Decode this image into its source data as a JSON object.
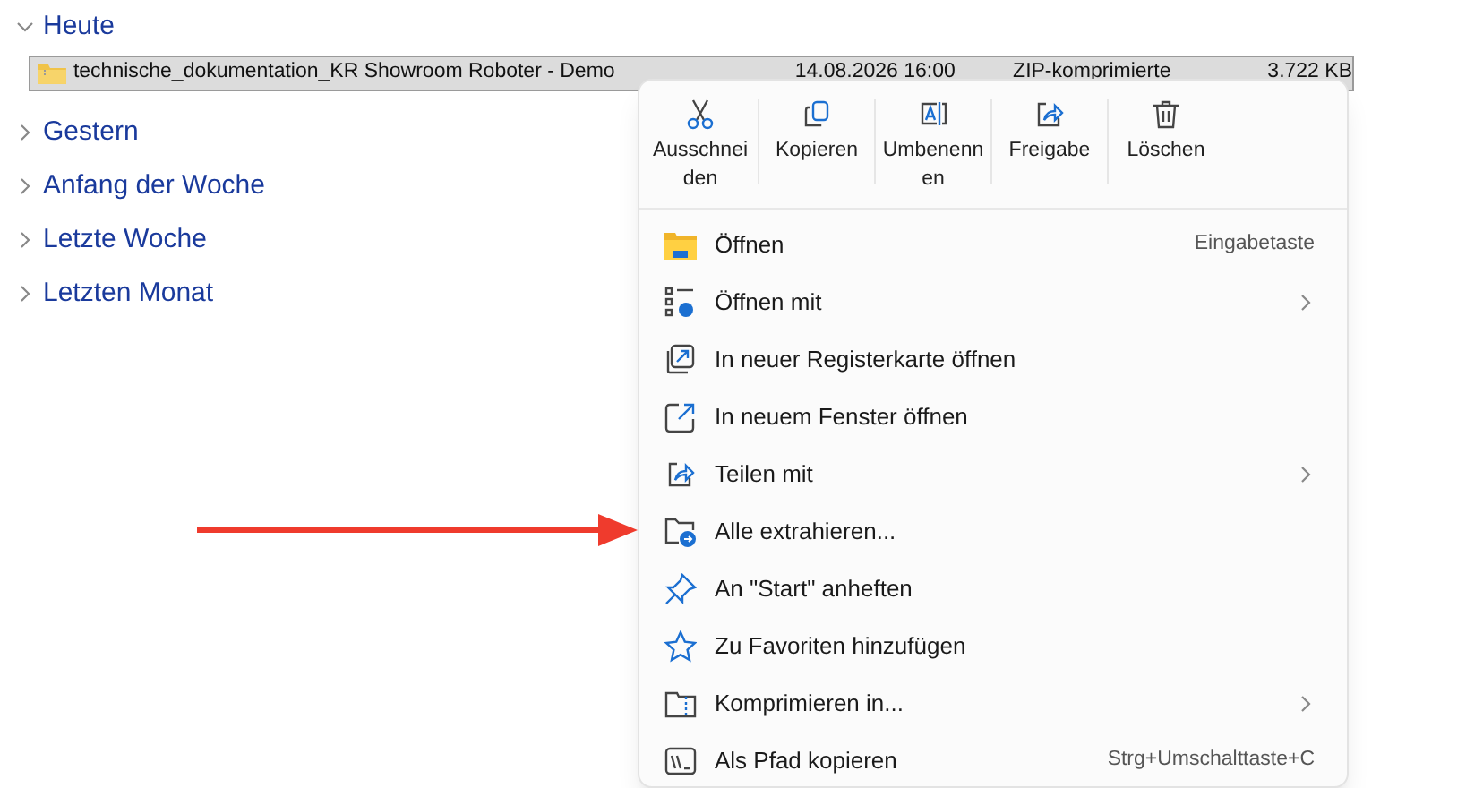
{
  "groups": [
    {
      "label": "Heute",
      "expanded": true,
      "files": [
        {
          "name": "technische_dokumentation_KR Showroom Roboter - Demo",
          "date": "14.08.2026 16:00",
          "type": "ZIP-komprimierte",
          "size": "3.722 KB",
          "selected": true
        }
      ]
    },
    {
      "label": "Gestern",
      "expanded": false
    },
    {
      "label": "Anfang der Woche",
      "expanded": false
    },
    {
      "label": "Letzte Woche",
      "expanded": false
    },
    {
      "label": "Letzten Monat",
      "expanded": false
    }
  ],
  "context_menu": {
    "actions": [
      {
        "label": "Ausschnei den"
      },
      {
        "label": "Kopieren"
      },
      {
        "label": "Umbenenn en"
      },
      {
        "label": "Freigabe"
      },
      {
        "label": "Löschen"
      }
    ],
    "items": [
      {
        "label": "Öffnen",
        "shortcut": "Eingabetaste",
        "submenu": false
      },
      {
        "label": "Öffnen mit",
        "submenu": true
      },
      {
        "label": "In neuer Registerkarte öffnen",
        "submenu": false
      },
      {
        "label": "In neuem Fenster öffnen",
        "submenu": false
      },
      {
        "label": "Teilen mit",
        "submenu": true
      },
      {
        "label": "Alle extrahieren...",
        "submenu": false
      },
      {
        "label": "An \"Start\" anheften",
        "submenu": false
      },
      {
        "label": "Zu Favoriten hinzufügen",
        "submenu": false
      },
      {
        "label": "Komprimieren in...",
        "submenu": true
      },
      {
        "label": "Als Pfad kopieren",
        "shortcut": "Strg+Umschalttaste+C",
        "submenu": false
      }
    ]
  }
}
